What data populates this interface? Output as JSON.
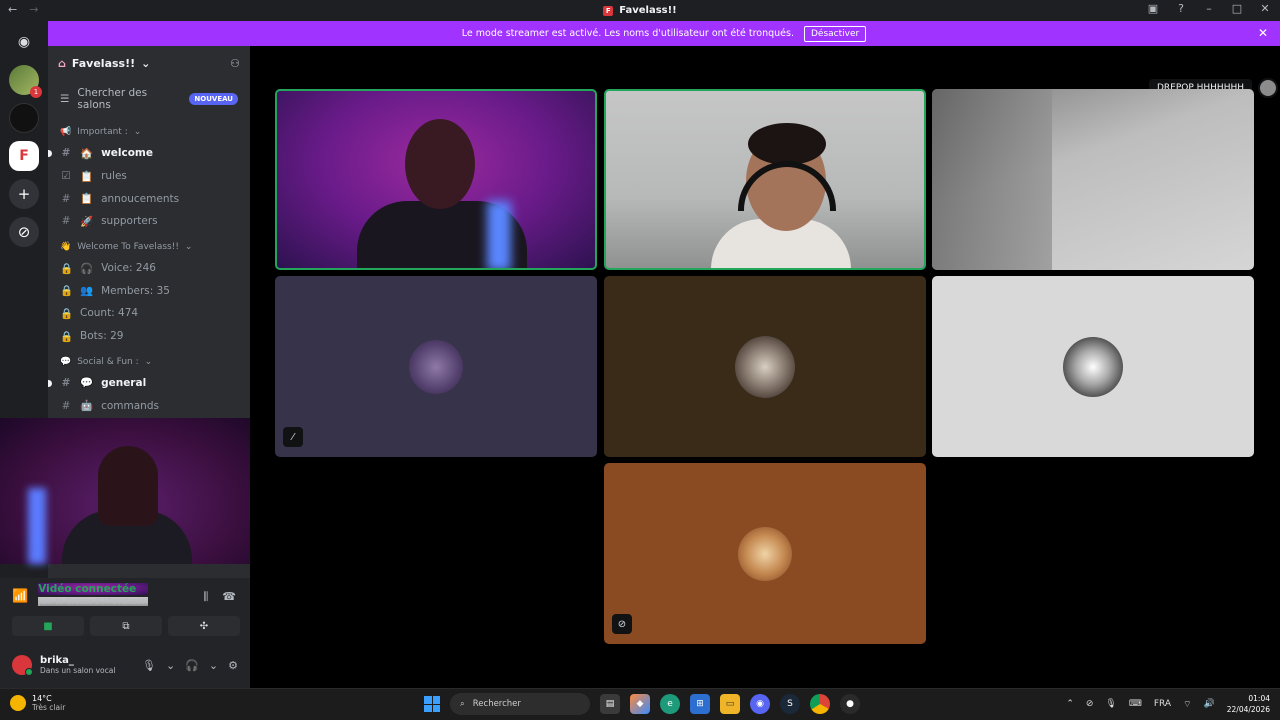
{
  "window": {
    "title": "Favelass!!",
    "logo_glyph": "F"
  },
  "banner": {
    "message": "Le mode streamer est activé. Les noms d'utilisateur ont été tronqués.",
    "button": "Désactiver",
    "color": "#a033ff"
  },
  "server": {
    "name": "Favelass!!",
    "search_label": "Chercher des salons",
    "new_badge": "NOUVEAU"
  },
  "channels": [
    {
      "type": "category",
      "emoji": "📢",
      "label": "Important :"
    },
    {
      "type": "text",
      "icon": "#",
      "emoji": "🏠",
      "label": "welcome",
      "unread": true
    },
    {
      "type": "rules",
      "icon": "☑",
      "emoji": "📋",
      "label": "rules",
      "unread": false
    },
    {
      "type": "text",
      "icon": "#",
      "emoji": "📋",
      "label": "annoucements",
      "unread": false
    },
    {
      "type": "text",
      "icon": "#",
      "emoji": "🚀",
      "label": "supporters",
      "unread": false
    },
    {
      "type": "category",
      "emoji": "👋",
      "label": "Welcome To Favelass!!"
    },
    {
      "type": "locked",
      "icon": "🔒",
      "emoji": "🎧",
      "label": "Voice: 246",
      "unread": false
    },
    {
      "type": "locked",
      "icon": "🔒",
      "emoji": "👥",
      "label": "Members: 35",
      "unread": false
    },
    {
      "type": "locked",
      "icon": "🔒",
      "emoji": "",
      "label": "Count: 474",
      "unread": false
    },
    {
      "type": "locked",
      "icon": "🔒",
      "emoji": "",
      "label": "Bots: 29",
      "unread": false
    },
    {
      "type": "category",
      "emoji": "💬",
      "label": "Social & Fun :"
    },
    {
      "type": "text",
      "icon": "#",
      "emoji": "💬",
      "label": "general",
      "unread": true
    },
    {
      "type": "text",
      "icon": "#",
      "emoji": "🤖",
      "label": "commands",
      "unread": false
    }
  ],
  "voice": {
    "status": "Vidéo connectée",
    "channel": "Join to Create 2 / Favelass!!"
  },
  "user": {
    "name": "brika_",
    "status": "Dans un salon vocal"
  },
  "stage": {
    "name_tag": "DREPOP HHHHHHH",
    "speaking_color": "#23a55a"
  },
  "taskbar": {
    "temp": "14°C",
    "weather": "Très clair",
    "search_placeholder": "Rechercher",
    "lang": "FRA",
    "time": "01:04",
    "date": "22/04/2026"
  }
}
